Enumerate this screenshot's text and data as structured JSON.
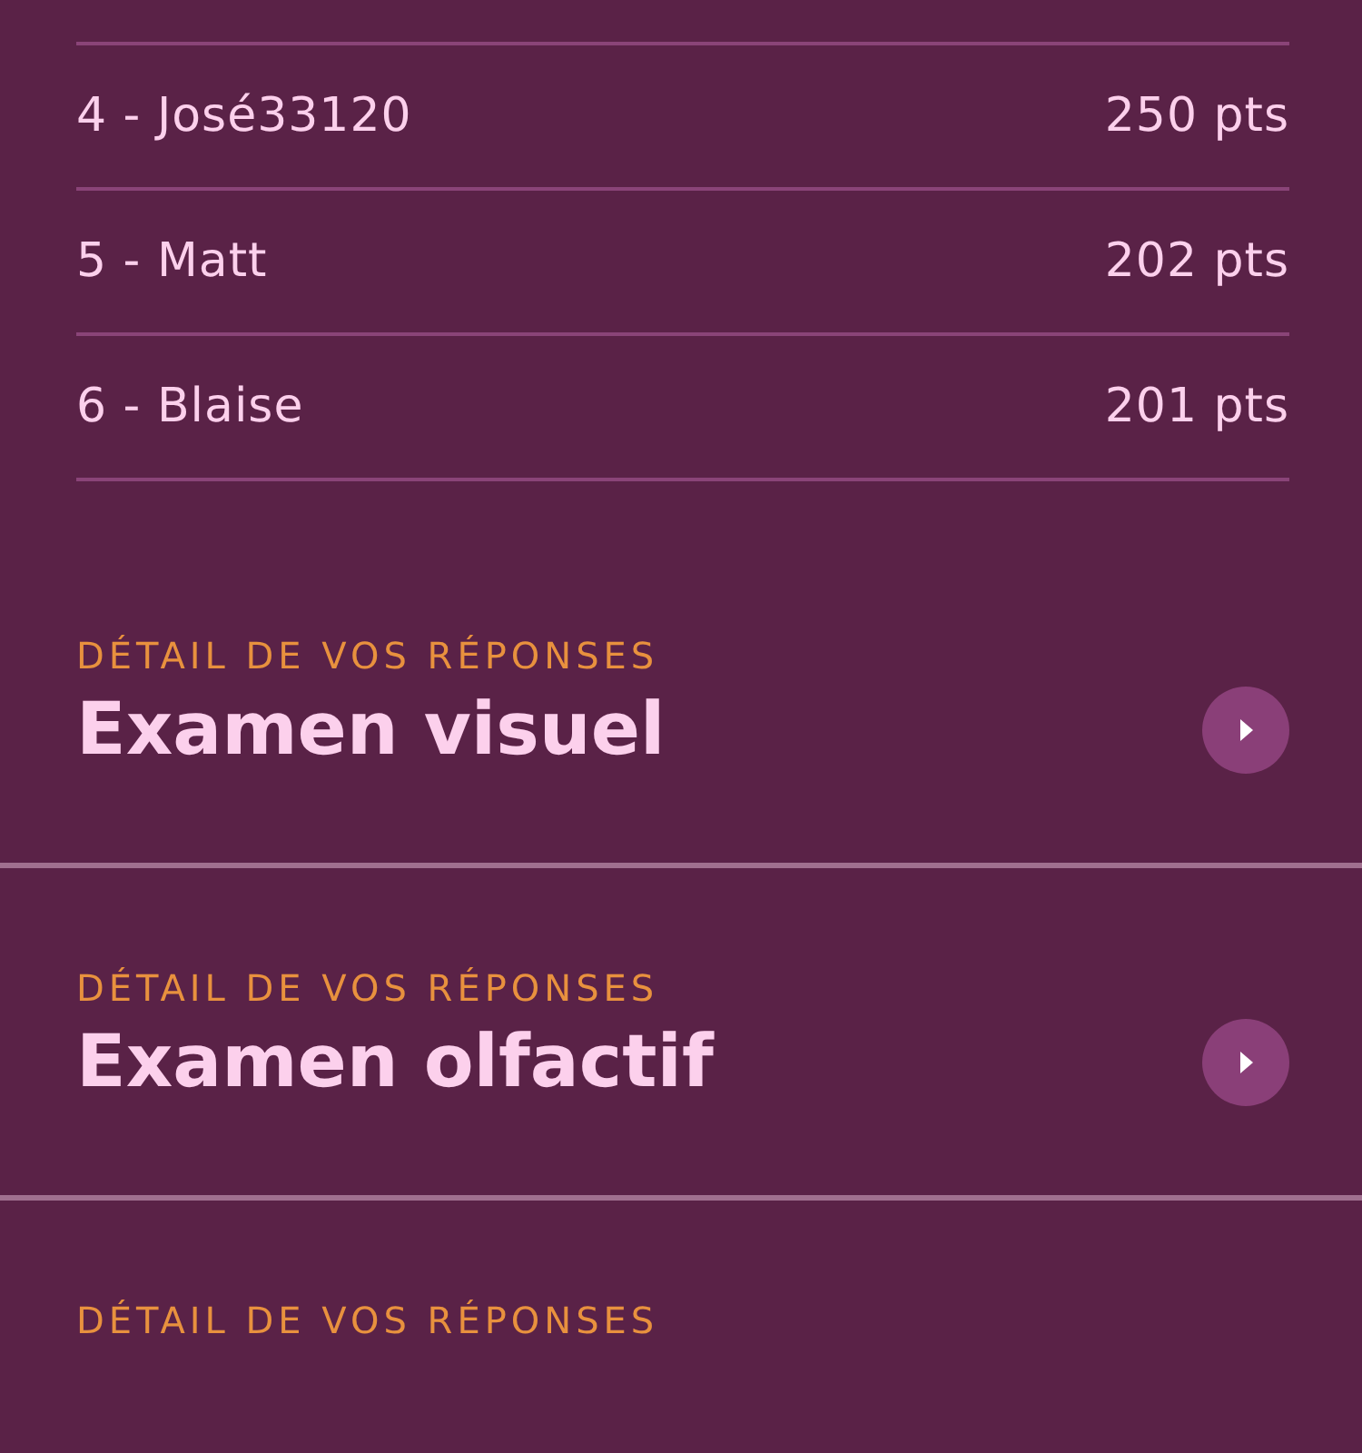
{
  "leaderboard": [
    {
      "player": "4 - José33120",
      "score": "250 pts"
    },
    {
      "player": "5 - Matt",
      "score": "202 pts"
    },
    {
      "player": "6 - Blaise",
      "score": "201 pts"
    }
  ],
  "sections": [
    {
      "eyebrow": "DÉTAIL DE VOS RÉPONSES",
      "title": "Examen visuel"
    },
    {
      "eyebrow": "DÉTAIL DE VOS RÉPONSES",
      "title": "Examen olfactif"
    },
    {
      "eyebrow": "DÉTAIL DE VOS RÉPONSES"
    }
  ]
}
